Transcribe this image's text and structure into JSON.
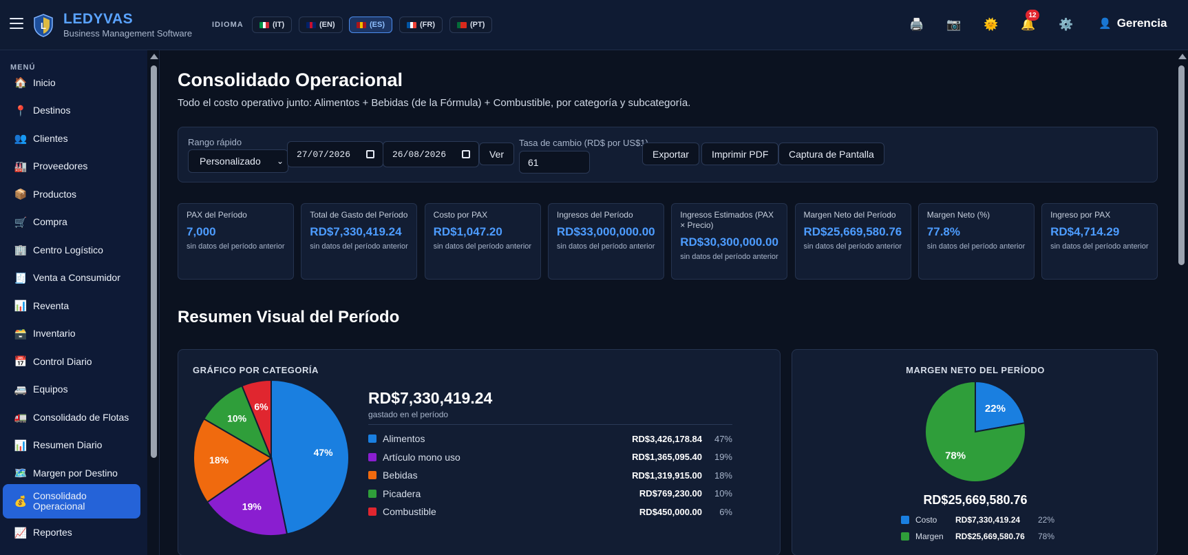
{
  "header": {
    "brand": "LEDYVAS",
    "brand_sub": "Business Management Software",
    "language_label": "IDIOMA",
    "languages": [
      {
        "code": "(IT)",
        "flag": "it",
        "active": false
      },
      {
        "code": "(EN)",
        "flag": "gb",
        "active": false
      },
      {
        "code": "(ES)",
        "flag": "es",
        "active": true
      },
      {
        "code": "(FR)",
        "flag": "fr",
        "active": false
      },
      {
        "code": "(PT)",
        "flag": "pt",
        "active": false
      }
    ],
    "notification_count": "12",
    "user": "Gerencia",
    "icons": [
      "print-icon",
      "camera-icon",
      "sun-icon",
      "bell-icon",
      "gear-icon"
    ]
  },
  "sidebar": {
    "menu_label": "MENÚ",
    "items": [
      {
        "label": "Inicio",
        "icon": "🏠"
      },
      {
        "label": "Destinos",
        "icon": "📍"
      },
      {
        "label": "Clientes",
        "icon": "👥"
      },
      {
        "label": "Proveedores",
        "icon": "🏭"
      },
      {
        "label": "Productos",
        "icon": "📦"
      },
      {
        "label": "Compra",
        "icon": "🛒"
      },
      {
        "label": "Centro Logístico",
        "icon": "🏢"
      },
      {
        "label": "Venta a Consumidor",
        "icon": "🧾"
      },
      {
        "label": "Reventa",
        "icon": "📊"
      },
      {
        "label": "Inventario",
        "icon": "🗃️"
      },
      {
        "label": "Control Diario",
        "icon": "📅"
      },
      {
        "label": "Equipos",
        "icon": "🚐"
      },
      {
        "label": "Consolidado de Flotas",
        "icon": "🚛"
      },
      {
        "label": "Resumen Diario",
        "icon": "📊"
      },
      {
        "label": "Margen por Destino",
        "icon": "🗺️"
      },
      {
        "label": "Consolidado Operacional",
        "icon": "💰",
        "active": true
      },
      {
        "label": "Reportes",
        "icon": "📈"
      }
    ]
  },
  "main": {
    "title": "Consolidado Operacional",
    "description": "Todo el costo operativo junto: Alimentos + Bebidas (de la Fórmula) + Combustible, por categoría y subcategoría.",
    "filters": {
      "range_label": "Rango rápido",
      "range_value": "Personalizado",
      "date_from": "27/07/2026",
      "date_to": "26/08/2026",
      "view_button": "Ver",
      "rate_label": "Tasa de cambio (RD$ por US$1)",
      "rate_value": "61",
      "export_button": "Exportar",
      "print_button": "Imprimir PDF",
      "screenshot_button": "Captura de Pantalla"
    },
    "kpis": [
      {
        "label": "PAX del Período",
        "value": "7,000",
        "note": "sin datos del período anterior"
      },
      {
        "label": "Total de Gasto del Período",
        "value": "RD$7,330,419.24",
        "note": "sin datos del período anterior"
      },
      {
        "label": "Costo por PAX",
        "value": "RD$1,047.20",
        "note": "sin datos del período anterior"
      },
      {
        "label": "Ingresos del Período",
        "value": "RD$33,000,000.00",
        "note": "sin datos del período anterior"
      },
      {
        "label": "Ingresos Estimados (PAX × Precio)",
        "value": "RD$30,300,000.00",
        "note": "sin datos del período anterior"
      },
      {
        "label": "Margen Neto del Período",
        "value": "RD$25,669,580.76",
        "note": "sin datos del período anterior"
      },
      {
        "label": "Margen Neto (%)",
        "value": "77.8%",
        "note": "sin datos del período anterior"
      },
      {
        "label": "Ingreso por PAX",
        "value": "RD$4,714.29",
        "note": "sin datos del período anterior"
      }
    ],
    "section_title": "Resumen Visual del Período",
    "category_card": {
      "title": "GRÁFICO POR CATEGORÍA",
      "total": "RD$7,330,419.24",
      "total_sub": "gastado en el período"
    },
    "margin_card": {
      "title": "MARGEN NETO DEL PERÍODO",
      "total": "RD$25,669,580.76"
    }
  },
  "chart_data": [
    {
      "type": "pie",
      "title": "GRÁFICO POR CATEGORÍA",
      "categories": [
        "Alimentos",
        "Artículo mono uso",
        "Bebidas",
        "Picadera",
        "Combustible"
      ],
      "values": [
        3426178.84,
        1365095.4,
        1319915.0,
        769230.0,
        450000.0
      ],
      "value_labels": [
        "RD$3,426,178.84",
        "RD$1,365,095.40",
        "RD$1,319,915.00",
        "RD$769,230.00",
        "RD$450,000.00"
      ],
      "percent_labels": [
        "47%",
        "19%",
        "18%",
        "10%",
        "6%"
      ],
      "colors": [
        "#1a7fe0",
        "#8a1ed0",
        "#f06a0e",
        "#2f9e3a",
        "#e0262f"
      ]
    },
    {
      "type": "pie",
      "title": "MARGEN NETO DEL PERÍODO",
      "categories": [
        "Costo",
        "Margen"
      ],
      "values": [
        7330419.24,
        25669580.76
      ],
      "value_labels": [
        "RD$7,330,419.24",
        "RD$25,669,580.76"
      ],
      "percent_labels": [
        "22%",
        "78%"
      ],
      "colors": [
        "#1a7fe0",
        "#2f9e3a"
      ]
    }
  ]
}
